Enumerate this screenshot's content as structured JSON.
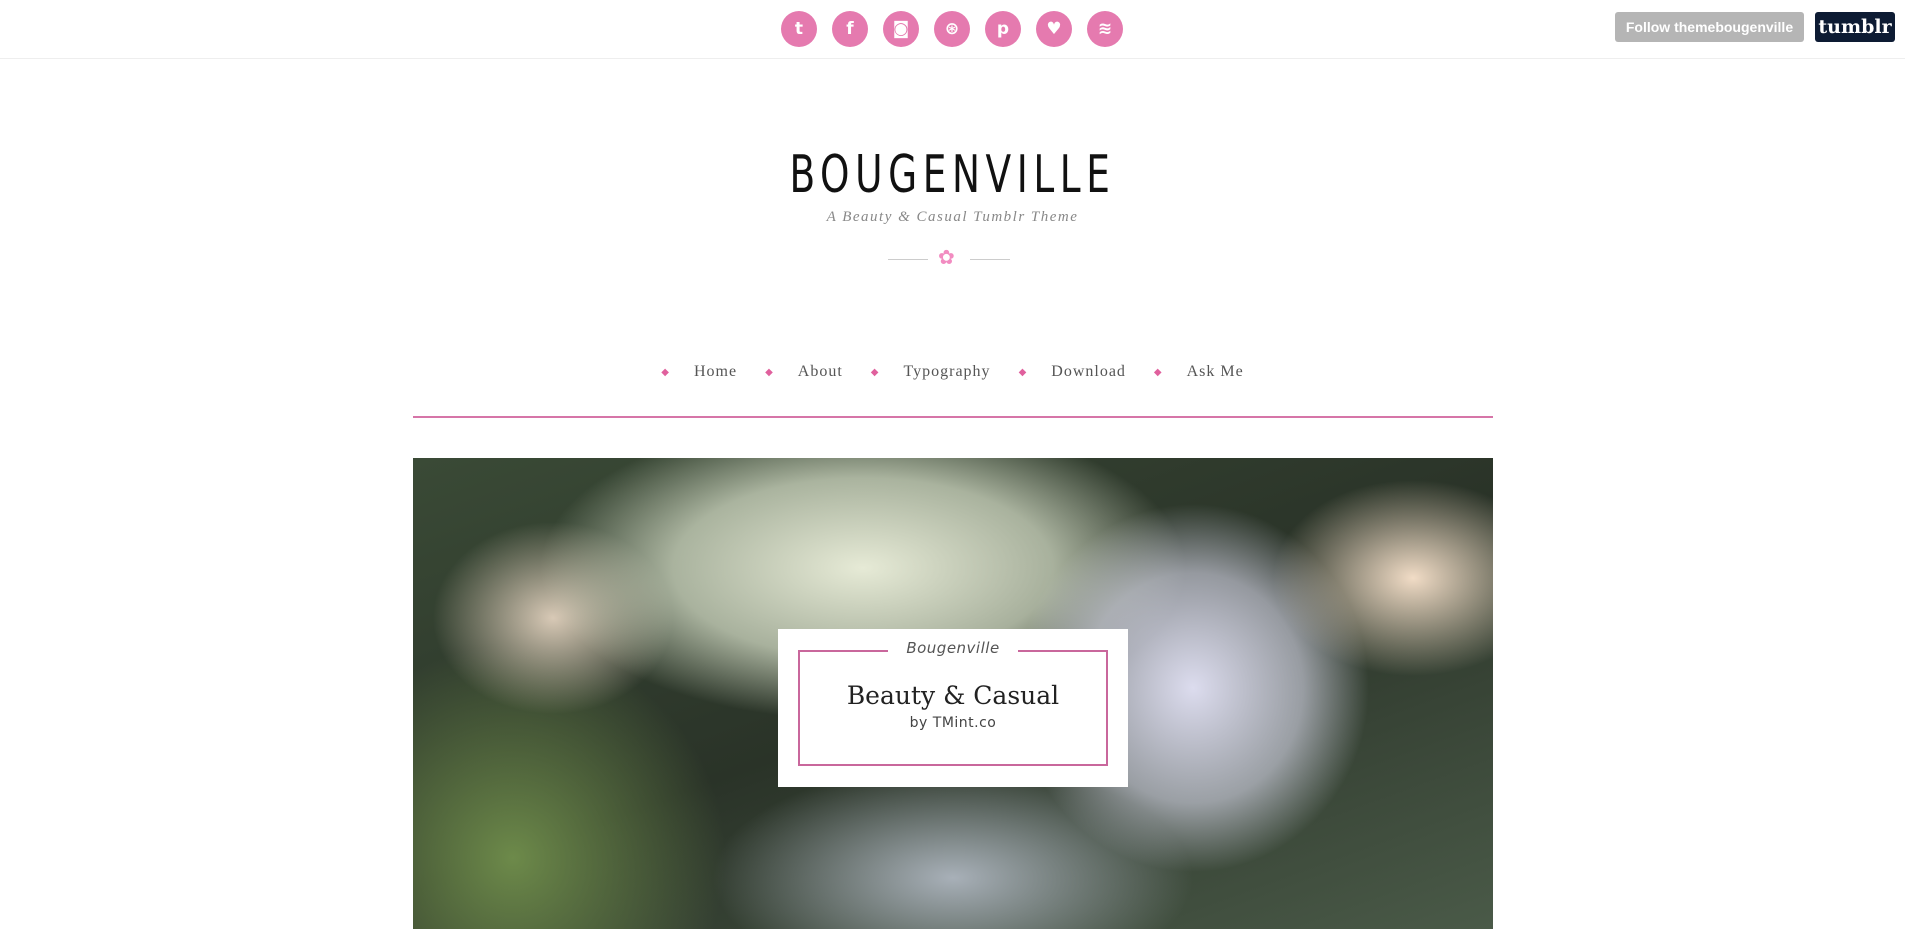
{
  "topbar": {
    "socials": [
      {
        "icon": "twitter-icon",
        "glyph": "t"
      },
      {
        "icon": "facebook-icon",
        "glyph": "f"
      },
      {
        "icon": "instagram-icon",
        "glyph": "◙"
      },
      {
        "icon": "dribbble-icon",
        "glyph": "⊛"
      },
      {
        "icon": "pinterest-icon",
        "glyph": "p"
      },
      {
        "icon": "heart-icon",
        "glyph": "♥"
      },
      {
        "icon": "rss-icon",
        "glyph": "≋"
      }
    ],
    "follow_label": "Follow themebougenville",
    "tumblr_label": "tumblr"
  },
  "header": {
    "title": "BOUGENVILLE",
    "tagline": "A Beauty & Casual Tumblr Theme",
    "flower": "✿"
  },
  "nav": {
    "items": [
      {
        "label": "Home"
      },
      {
        "label": "About"
      },
      {
        "label": "Typography"
      },
      {
        "label": "Download"
      },
      {
        "label": "Ask Me"
      }
    ],
    "bullet": "◆"
  },
  "hero": {
    "kicker": "Bougenville",
    "headline": "Beauty & Casual",
    "byline": "by TMint.co"
  },
  "colors": {
    "accent": "#e57aaf",
    "nav_line": "#d675a8",
    "tumblr": "#0d1b33"
  }
}
